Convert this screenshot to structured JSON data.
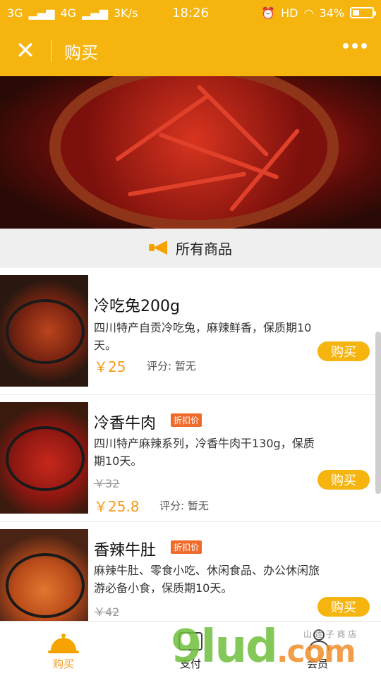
{
  "status_bar": {
    "signal_left": "3G",
    "signal_second": "4G",
    "speed": "3K/s",
    "time": "18:26",
    "hd": "HD",
    "battery": "34%",
    "battery_level": 0.34
  },
  "header": {
    "close_icon": "close-icon",
    "title": "购买",
    "more_icon": "more-dots-icon"
  },
  "section": {
    "icon": "megaphone-icon",
    "title": "所有商品"
  },
  "products": [
    {
      "name": "冷吃兔200g",
      "tag": "",
      "description": "四川特产自贡冷吃兔，麻辣鲜香，保质期10天。",
      "old_price": "",
      "price": "￥25",
      "rating": "评分: 暂无",
      "buy_label": "购买"
    },
    {
      "name": "冷香牛肉",
      "tag": "折扣价",
      "description": "四川特产麻辣系列，冷香牛肉干130g，保质期10天。",
      "old_price": "￥32",
      "price": "￥25.8",
      "rating": "评分: 暂无",
      "buy_label": "购买"
    },
    {
      "name": "香辣牛肚",
      "tag": "折扣价",
      "description": "麻辣牛肚、零食小吃、休闲食品、办公休闲旅游必备小食，保质期10天。",
      "old_price": "￥42",
      "price": "",
      "rating": "",
      "buy_label": "购买"
    }
  ],
  "tabs": [
    {
      "label": "购买",
      "icon": "cloche-icon",
      "active": true
    },
    {
      "label": "支付",
      "icon": "wallet-icon",
      "active": false
    },
    {
      "label": "会员",
      "icon": "person-icon",
      "active": false
    }
  ],
  "watermark": {
    "text": "9lud",
    "suffix": ".com",
    "small": "山 莲 子 商 店"
  },
  "colors": {
    "accent": "#f6b40e",
    "price": "#f39a1b",
    "tag": "#f06a2a"
  }
}
